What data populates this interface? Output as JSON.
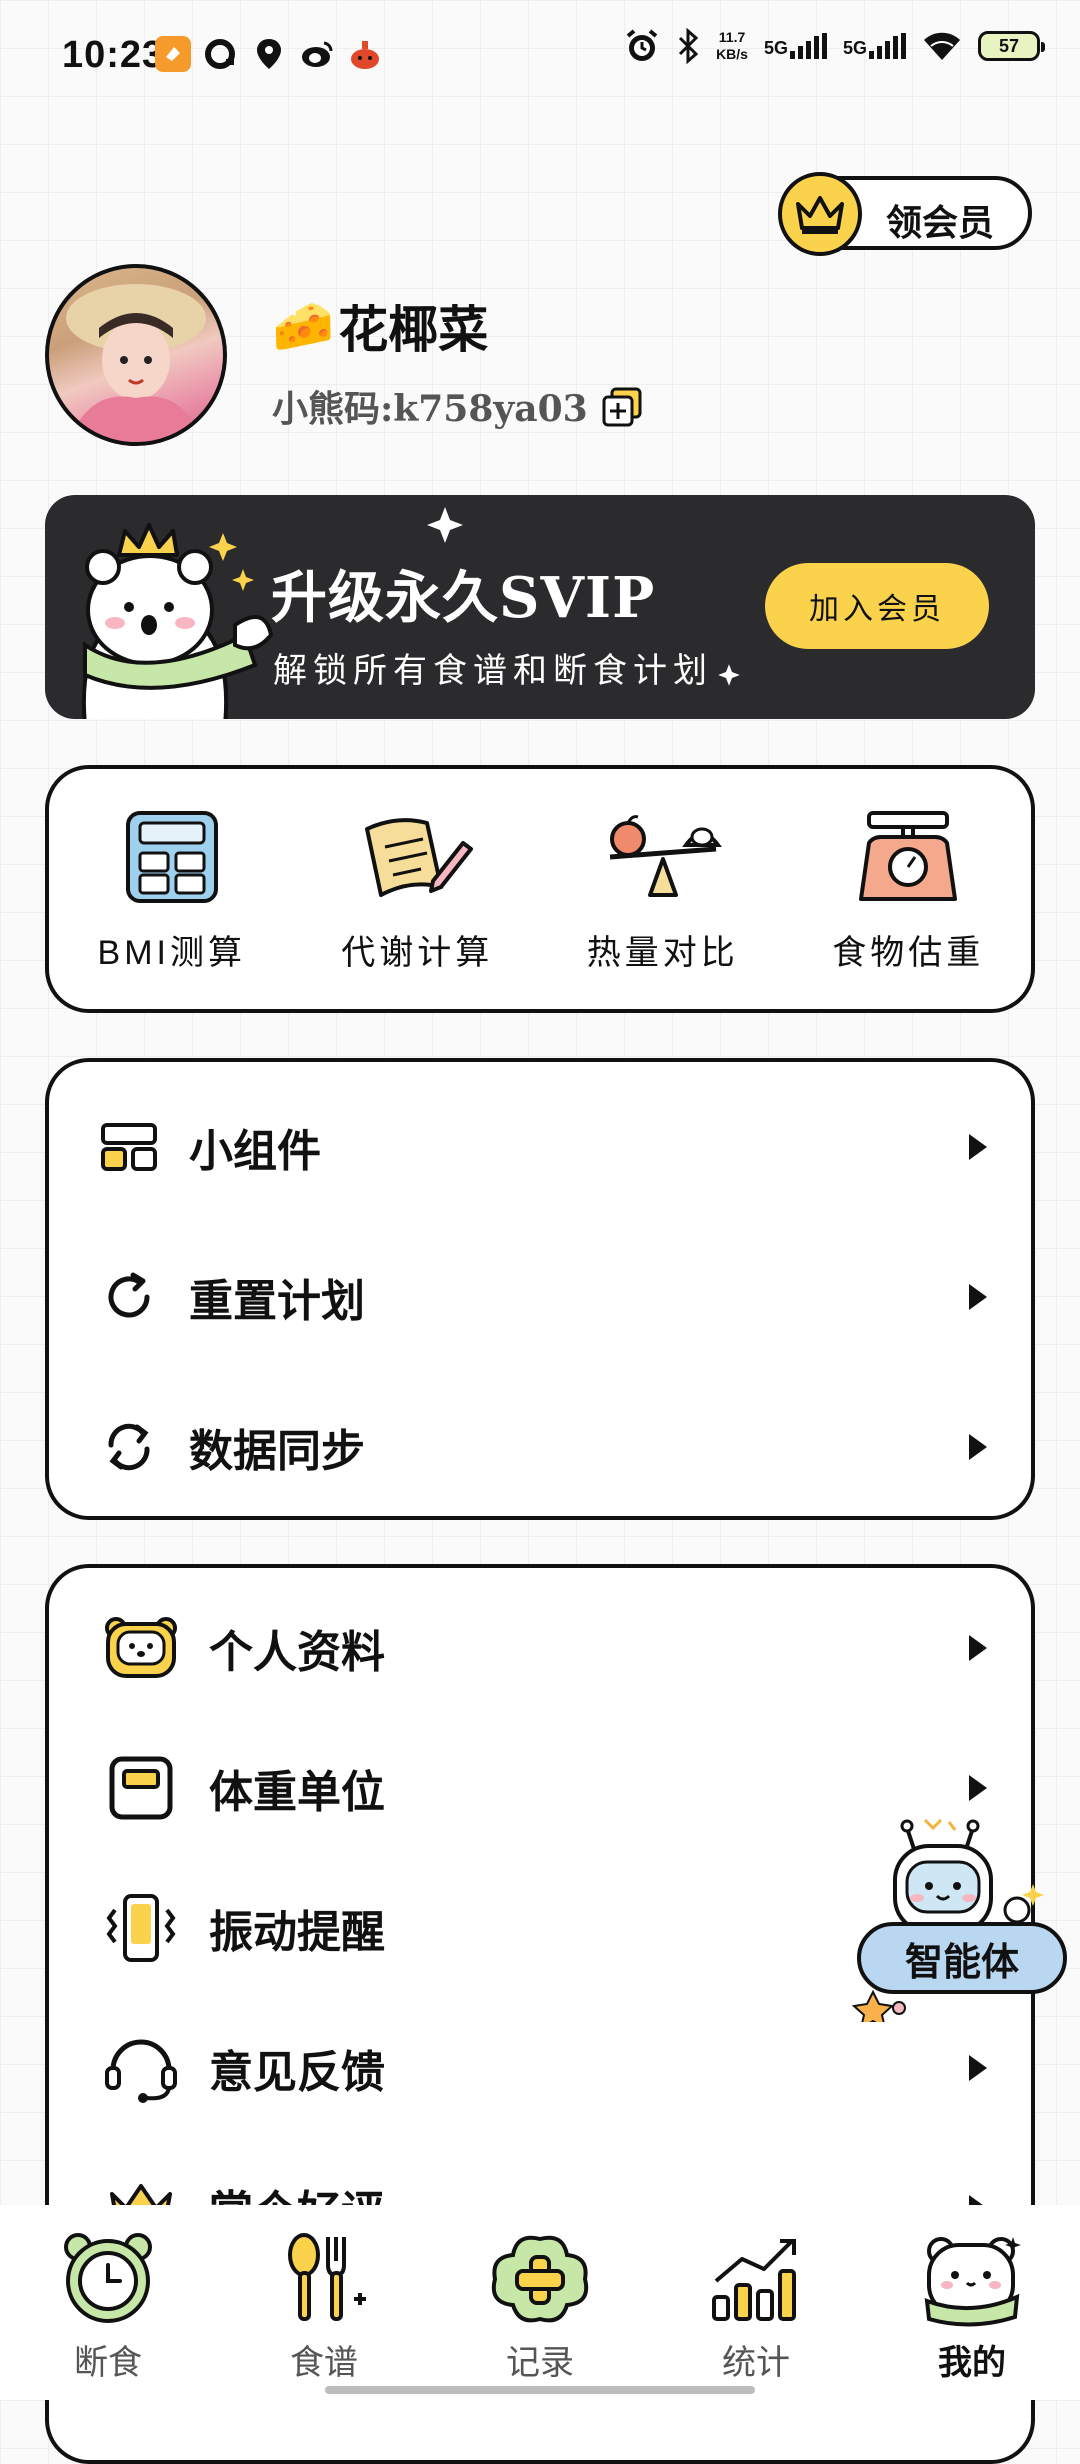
{
  "status_bar": {
    "time": "10:23",
    "net_speed_value": "11.7",
    "net_speed_unit": "KB/s",
    "sim1": "5G",
    "sim2": "5G",
    "battery": "57"
  },
  "vip_pill": {
    "label": "领会员",
    "icon": "crown-icon"
  },
  "profile": {
    "name_emoji": "🧀",
    "name": "花椰菜",
    "code": "小熊码:k758ya03"
  },
  "svip_banner": {
    "title": "升级永久SVIP",
    "subtitle": "解锁所有食谱和断食计划",
    "button": "加入会员",
    "accent": "#fbd24b",
    "background": "#2b2b2e"
  },
  "tools": [
    {
      "label": "BMI测算",
      "icon": "calculator-icon"
    },
    {
      "label": "代谢计算",
      "icon": "document-pen-icon"
    },
    {
      "label": "热量对比",
      "icon": "balance-scale-icon"
    },
    {
      "label": "食物估重",
      "icon": "kitchen-scale-icon"
    }
  ],
  "menu_group_1": [
    {
      "label": "小组件",
      "icon": "widget-icon"
    },
    {
      "label": "重置计划",
      "icon": "reset-icon"
    },
    {
      "label": "数据同步",
      "icon": "sync-icon"
    }
  ],
  "menu_group_2": [
    {
      "label": "个人资料",
      "icon": "bear-profile-icon"
    },
    {
      "label": "体重单位",
      "icon": "scale-unit-icon"
    },
    {
      "label": "振动提醒",
      "icon": "vibration-icon"
    },
    {
      "label": "意见反馈",
      "icon": "headset-icon"
    },
    {
      "label": "赏个好评",
      "icon": "crown-icon"
    }
  ],
  "floating_agent": {
    "label": "智能体"
  },
  "bottom_nav": [
    {
      "label": "断食",
      "icon": "clock-icon",
      "active": false
    },
    {
      "label": "食谱",
      "icon": "utensils-icon",
      "active": false
    },
    {
      "label": "记录",
      "icon": "add-record-icon",
      "active": false
    },
    {
      "label": "统计",
      "icon": "chart-icon",
      "active": false
    },
    {
      "label": "我的",
      "icon": "bear-icon",
      "active": true
    }
  ]
}
